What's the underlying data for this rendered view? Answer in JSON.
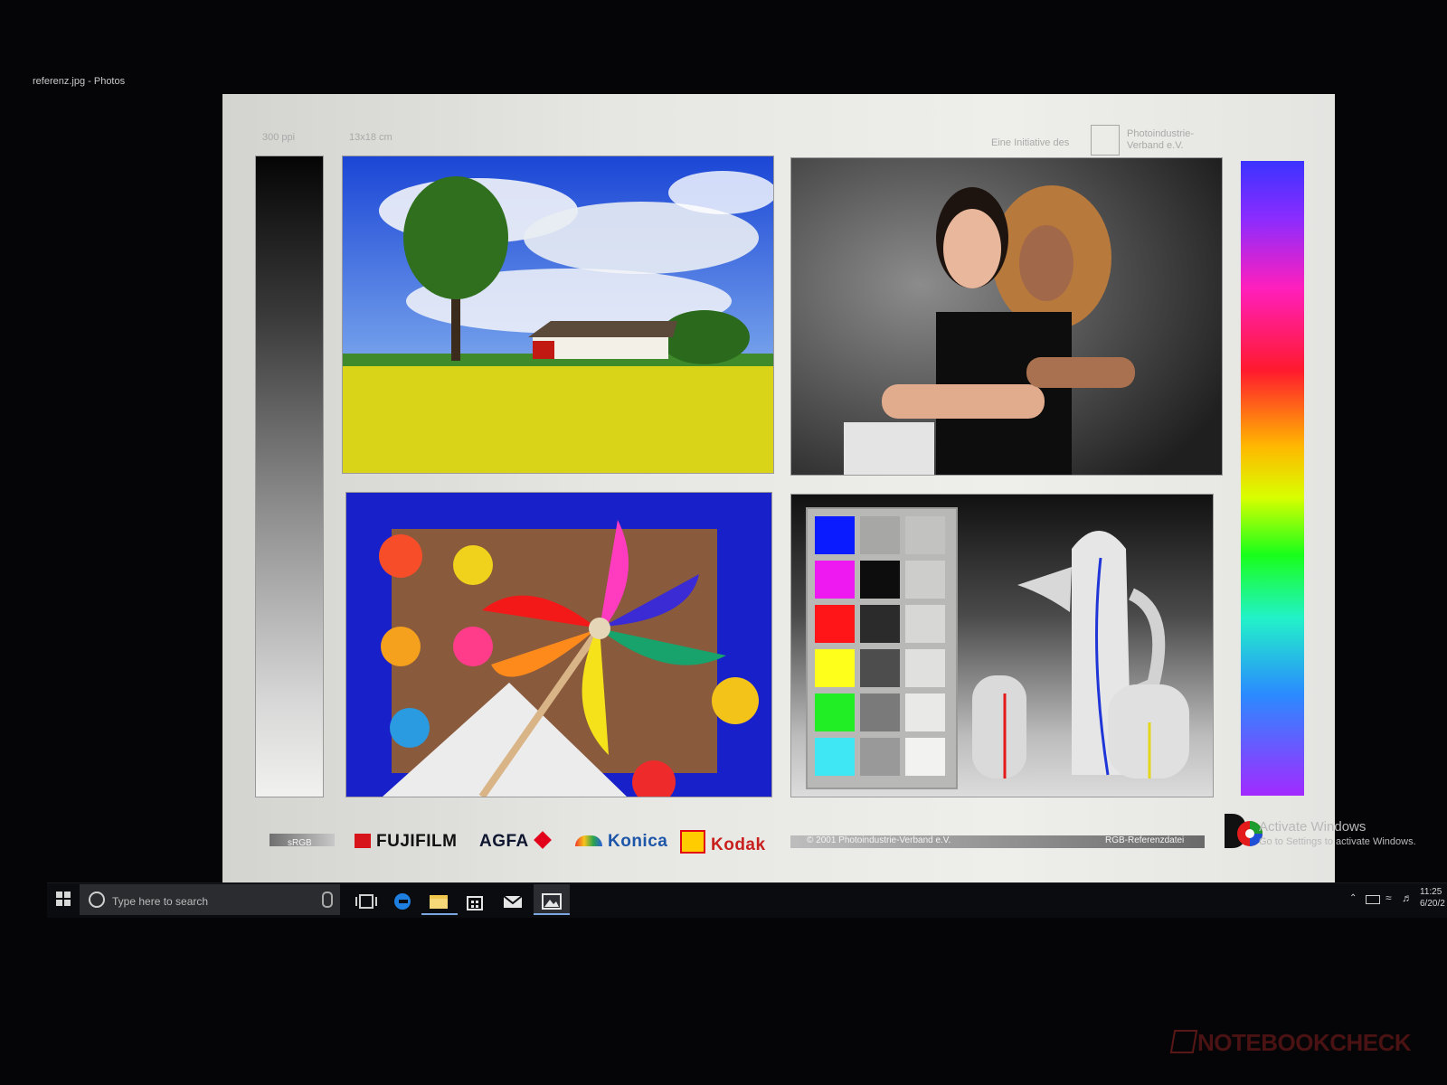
{
  "window": {
    "title": "referenz.jpg - Photos"
  },
  "sheet": {
    "resolution_label": "300 ppi",
    "size_label": "13x18 cm",
    "initiative_label": "Eine Initiative des",
    "org_line1": "Photoindustrie-",
    "org_line2": "Verband e.V.",
    "srgb_label": "sRGB",
    "brands": [
      "FUJIFILM",
      "AGFA",
      "Konica",
      "Kodak"
    ],
    "copyright": "© 2001 Photoindustrie-Verband e.V.",
    "file_label": "RGB-Referenzdatei",
    "colors": {
      "patch_colors": [
        "#0a1bff",
        "#ee18f0",
        "#ff1418",
        "#ffff1c",
        "#22ee25",
        "#3fe6f4"
      ],
      "dark_grays": [
        "#a7a7a5",
        "#0d0d0d",
        "#2b2b2b",
        "#4d4d4d",
        "#7a7a7a",
        "#999999"
      ],
      "light_grays": [
        "#c2c2c0",
        "#cdcdcb",
        "#d7d7d5",
        "#e0e0de",
        "#e9e9e7",
        "#f2f2f0"
      ]
    }
  },
  "activation": {
    "title": "Activate Windows",
    "subtitle": "Go to Settings to activate Windows."
  },
  "taskbar": {
    "search_placeholder": "Type here to search",
    "icons": [
      "windows-start-icon",
      "search-circle-icon",
      "microphone-icon",
      "task-view-icon",
      "edge-icon",
      "file-explorer-icon",
      "store-icon",
      "mail-icon",
      "photos-icon"
    ],
    "time": "11:25",
    "date": "6/20/2"
  },
  "watermark": "NOTEBOOKCHECK"
}
